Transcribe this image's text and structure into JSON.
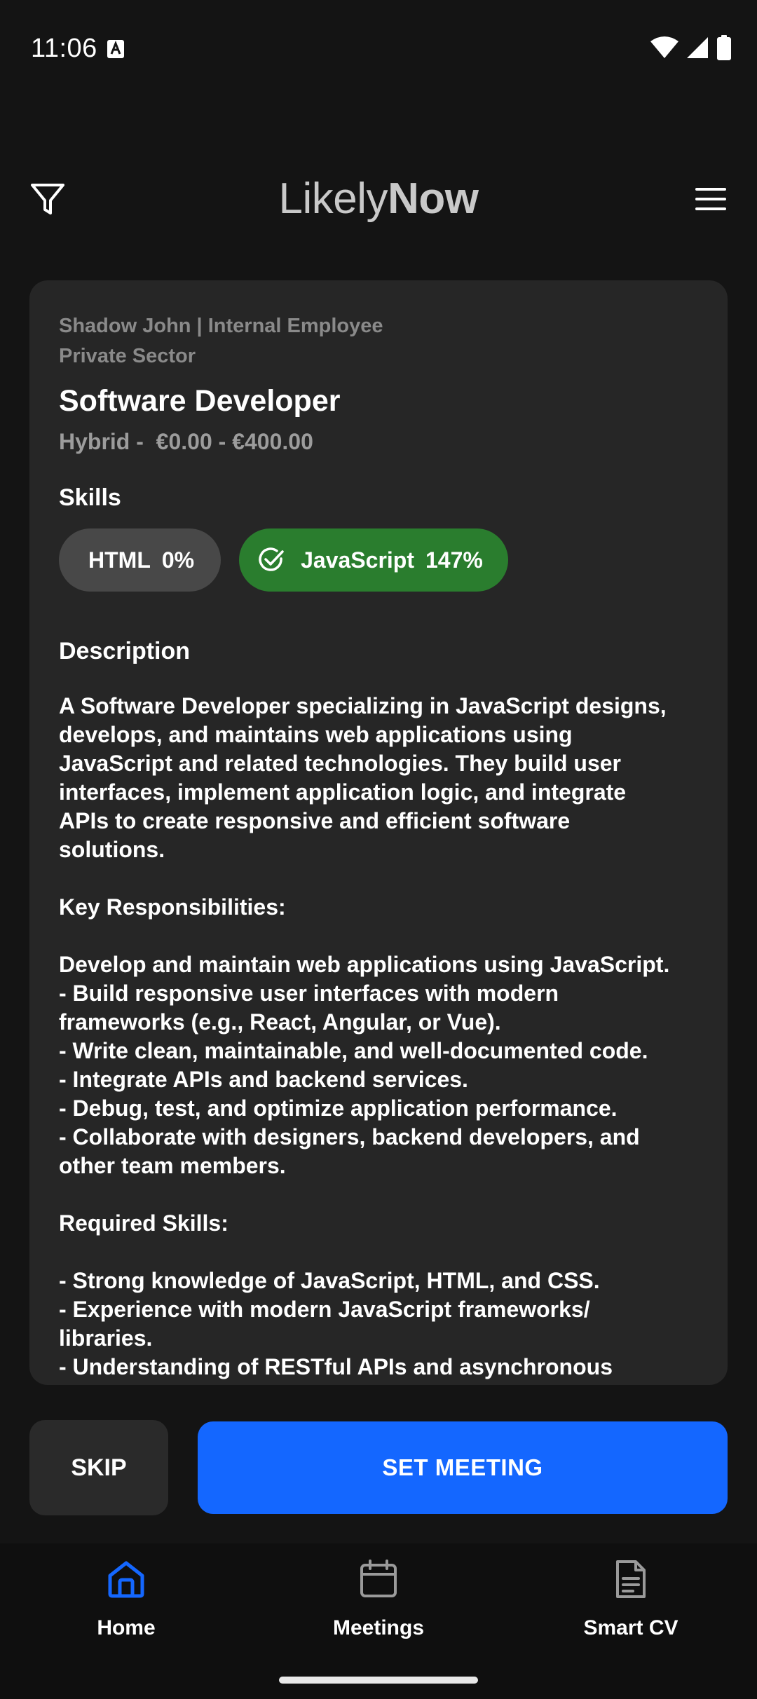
{
  "status_bar": {
    "time": "11:06",
    "icons": [
      "keyboard-a-icon",
      "wifi-icon",
      "signal-icon",
      "battery-icon"
    ]
  },
  "header": {
    "logo_light": "Likely",
    "logo_bold": "Now",
    "left_icon": "filter-icon",
    "right_icon": "menu-icon"
  },
  "job": {
    "company_line1": "Shadow John | Internal Employee",
    "company_line2": "Private Sector",
    "title": "Software Developer",
    "meta": "Hybrid -  €0.00 - €400.00",
    "skills_heading": "Skills",
    "skills": [
      {
        "name": "HTML",
        "match": "0%",
        "matched": false
      },
      {
        "name": "JavaScript",
        "match": "147%",
        "matched": true
      }
    ],
    "description_heading": "Description",
    "description": "A Software Developer specializing in JavaScript designs,\ndevelops, and maintains web applications using\nJavaScript and related technologies. They build user\ninterfaces, implement application logic, and integrate\nAPIs to create responsive and efficient software\nsolutions.\n\nKey Responsibilities:\n\nDevelop and maintain web applications using JavaScript.\n- Build responsive user interfaces with modern\nframeworks (e.g., React, Angular, or Vue).\n- Write clean, maintainable, and well-documented code.\n- Integrate APIs and backend services.\n- Debug, test, and optimize application performance.\n- Collaborate with designers, backend developers, and\nother team members.\n\nRequired Skills:\n\n- Strong knowledge of JavaScript, HTML, and CSS.\n- Experience with modern JavaScript frameworks/\nlibraries.\n- Understanding of RESTful APIs and asynchronous"
  },
  "actions": {
    "skip_label": "SKIP",
    "meeting_label": "SET MEETING"
  },
  "bottom_nav": {
    "items": [
      {
        "label": "Home",
        "icon": "home-icon",
        "active": true
      },
      {
        "label": "Meetings",
        "icon": "calendar-icon",
        "active": false
      },
      {
        "label": "Smart CV",
        "icon": "document-icon",
        "active": false
      }
    ]
  },
  "colors": {
    "background": "#141414",
    "card": "#262626",
    "accent_blue": "#1467ff",
    "match_green": "#2a7d2e",
    "chip_gray": "#484848"
  }
}
